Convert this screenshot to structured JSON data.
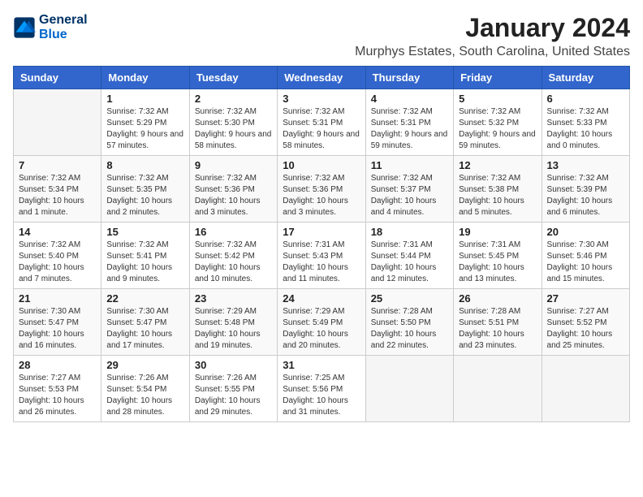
{
  "logo": {
    "line1": "General",
    "line2": "Blue"
  },
  "title": "January 2024",
  "subtitle": "Murphys Estates, South Carolina, United States",
  "days_of_week": [
    "Sunday",
    "Monday",
    "Tuesday",
    "Wednesday",
    "Thursday",
    "Friday",
    "Saturday"
  ],
  "weeks": [
    [
      {
        "day": "",
        "sunrise": "",
        "sunset": "",
        "daylight": ""
      },
      {
        "day": "1",
        "sunrise": "Sunrise: 7:32 AM",
        "sunset": "Sunset: 5:29 PM",
        "daylight": "Daylight: 9 hours and 57 minutes."
      },
      {
        "day": "2",
        "sunrise": "Sunrise: 7:32 AM",
        "sunset": "Sunset: 5:30 PM",
        "daylight": "Daylight: 9 hours and 58 minutes."
      },
      {
        "day": "3",
        "sunrise": "Sunrise: 7:32 AM",
        "sunset": "Sunset: 5:31 PM",
        "daylight": "Daylight: 9 hours and 58 minutes."
      },
      {
        "day": "4",
        "sunrise": "Sunrise: 7:32 AM",
        "sunset": "Sunset: 5:31 PM",
        "daylight": "Daylight: 9 hours and 59 minutes."
      },
      {
        "day": "5",
        "sunrise": "Sunrise: 7:32 AM",
        "sunset": "Sunset: 5:32 PM",
        "daylight": "Daylight: 9 hours and 59 minutes."
      },
      {
        "day": "6",
        "sunrise": "Sunrise: 7:32 AM",
        "sunset": "Sunset: 5:33 PM",
        "daylight": "Daylight: 10 hours and 0 minutes."
      }
    ],
    [
      {
        "day": "7",
        "sunrise": "Sunrise: 7:32 AM",
        "sunset": "Sunset: 5:34 PM",
        "daylight": "Daylight: 10 hours and 1 minute."
      },
      {
        "day": "8",
        "sunrise": "Sunrise: 7:32 AM",
        "sunset": "Sunset: 5:35 PM",
        "daylight": "Daylight: 10 hours and 2 minutes."
      },
      {
        "day": "9",
        "sunrise": "Sunrise: 7:32 AM",
        "sunset": "Sunset: 5:36 PM",
        "daylight": "Daylight: 10 hours and 3 minutes."
      },
      {
        "day": "10",
        "sunrise": "Sunrise: 7:32 AM",
        "sunset": "Sunset: 5:36 PM",
        "daylight": "Daylight: 10 hours and 3 minutes."
      },
      {
        "day": "11",
        "sunrise": "Sunrise: 7:32 AM",
        "sunset": "Sunset: 5:37 PM",
        "daylight": "Daylight: 10 hours and 4 minutes."
      },
      {
        "day": "12",
        "sunrise": "Sunrise: 7:32 AM",
        "sunset": "Sunset: 5:38 PM",
        "daylight": "Daylight: 10 hours and 5 minutes."
      },
      {
        "day": "13",
        "sunrise": "Sunrise: 7:32 AM",
        "sunset": "Sunset: 5:39 PM",
        "daylight": "Daylight: 10 hours and 6 minutes."
      }
    ],
    [
      {
        "day": "14",
        "sunrise": "Sunrise: 7:32 AM",
        "sunset": "Sunset: 5:40 PM",
        "daylight": "Daylight: 10 hours and 7 minutes."
      },
      {
        "day": "15",
        "sunrise": "Sunrise: 7:32 AM",
        "sunset": "Sunset: 5:41 PM",
        "daylight": "Daylight: 10 hours and 9 minutes."
      },
      {
        "day": "16",
        "sunrise": "Sunrise: 7:32 AM",
        "sunset": "Sunset: 5:42 PM",
        "daylight": "Daylight: 10 hours and 10 minutes."
      },
      {
        "day": "17",
        "sunrise": "Sunrise: 7:31 AM",
        "sunset": "Sunset: 5:43 PM",
        "daylight": "Daylight: 10 hours and 11 minutes."
      },
      {
        "day": "18",
        "sunrise": "Sunrise: 7:31 AM",
        "sunset": "Sunset: 5:44 PM",
        "daylight": "Daylight: 10 hours and 12 minutes."
      },
      {
        "day": "19",
        "sunrise": "Sunrise: 7:31 AM",
        "sunset": "Sunset: 5:45 PM",
        "daylight": "Daylight: 10 hours and 13 minutes."
      },
      {
        "day": "20",
        "sunrise": "Sunrise: 7:30 AM",
        "sunset": "Sunset: 5:46 PM",
        "daylight": "Daylight: 10 hours and 15 minutes."
      }
    ],
    [
      {
        "day": "21",
        "sunrise": "Sunrise: 7:30 AM",
        "sunset": "Sunset: 5:47 PM",
        "daylight": "Daylight: 10 hours and 16 minutes."
      },
      {
        "day": "22",
        "sunrise": "Sunrise: 7:30 AM",
        "sunset": "Sunset: 5:47 PM",
        "daylight": "Daylight: 10 hours and 17 minutes."
      },
      {
        "day": "23",
        "sunrise": "Sunrise: 7:29 AM",
        "sunset": "Sunset: 5:48 PM",
        "daylight": "Daylight: 10 hours and 19 minutes."
      },
      {
        "day": "24",
        "sunrise": "Sunrise: 7:29 AM",
        "sunset": "Sunset: 5:49 PM",
        "daylight": "Daylight: 10 hours and 20 minutes."
      },
      {
        "day": "25",
        "sunrise": "Sunrise: 7:28 AM",
        "sunset": "Sunset: 5:50 PM",
        "daylight": "Daylight: 10 hours and 22 minutes."
      },
      {
        "day": "26",
        "sunrise": "Sunrise: 7:28 AM",
        "sunset": "Sunset: 5:51 PM",
        "daylight": "Daylight: 10 hours and 23 minutes."
      },
      {
        "day": "27",
        "sunrise": "Sunrise: 7:27 AM",
        "sunset": "Sunset: 5:52 PM",
        "daylight": "Daylight: 10 hours and 25 minutes."
      }
    ],
    [
      {
        "day": "28",
        "sunrise": "Sunrise: 7:27 AM",
        "sunset": "Sunset: 5:53 PM",
        "daylight": "Daylight: 10 hours and 26 minutes."
      },
      {
        "day": "29",
        "sunrise": "Sunrise: 7:26 AM",
        "sunset": "Sunset: 5:54 PM",
        "daylight": "Daylight: 10 hours and 28 minutes."
      },
      {
        "day": "30",
        "sunrise": "Sunrise: 7:26 AM",
        "sunset": "Sunset: 5:55 PM",
        "daylight": "Daylight: 10 hours and 29 minutes."
      },
      {
        "day": "31",
        "sunrise": "Sunrise: 7:25 AM",
        "sunset": "Sunset: 5:56 PM",
        "daylight": "Daylight: 10 hours and 31 minutes."
      },
      {
        "day": "",
        "sunrise": "",
        "sunset": "",
        "daylight": ""
      },
      {
        "day": "",
        "sunrise": "",
        "sunset": "",
        "daylight": ""
      },
      {
        "day": "",
        "sunrise": "",
        "sunset": "",
        "daylight": ""
      }
    ]
  ]
}
